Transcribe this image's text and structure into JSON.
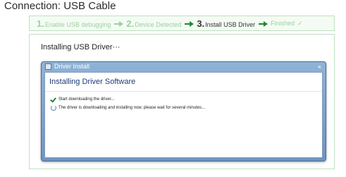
{
  "page": {
    "title": "Connection: USB Cable"
  },
  "steps": [
    {
      "num": "1.",
      "label": "Enable USB debugging",
      "state": "done"
    },
    {
      "num": "2.",
      "label": "Device Detected",
      "state": "done"
    },
    {
      "num": "3.",
      "label": "Install USB Driver",
      "state": "active"
    },
    {
      "num": "",
      "label": "Finished",
      "state": "pending"
    }
  ],
  "panel": {
    "title": "Installing USB Driver···"
  },
  "dialog": {
    "window_title": "Driver Install",
    "close_glyph": "×",
    "heading": "Installing Driver Software",
    "status": [
      {
        "text": "Start downloading the driver...",
        "icon": "check-icon"
      },
      {
        "text": "The driver is downloading and installing now, please wait for several minutes...",
        "icon": "loading-spinner-icon"
      }
    ]
  },
  "colors": {
    "step_inactive": "#9bd19f",
    "step_active": "#333333",
    "arrow_active": "#1e8a2e",
    "titlebar": "#7fa3cb",
    "heading": "#1e3a78"
  }
}
